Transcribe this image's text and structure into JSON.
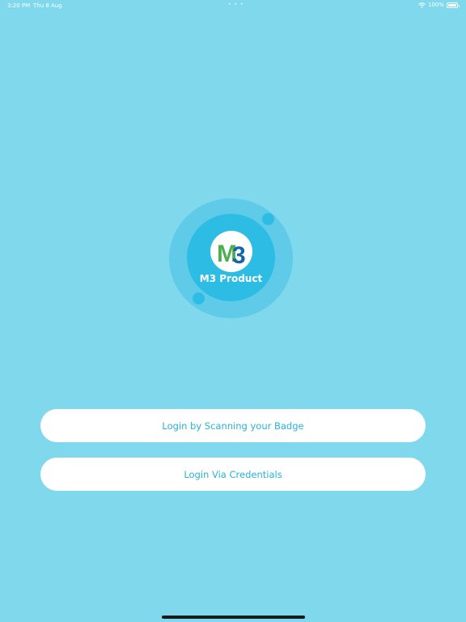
{
  "status_bar": {
    "time": "3:20 PM",
    "date": "Thu 8 Aug",
    "dots": "• • •",
    "battery": "100%"
  },
  "logo": {
    "mark": "M3",
    "product_name": "M3 Product",
    "colors": {
      "m": "#4caf50",
      "three": "#1565a8"
    }
  },
  "actions": {
    "scan_badge_label": "Login by Scanning your Badge",
    "credentials_label": "Login Via Credentials"
  },
  "colors": {
    "background": "#80d8ec",
    "accent": "#29b3d8"
  }
}
